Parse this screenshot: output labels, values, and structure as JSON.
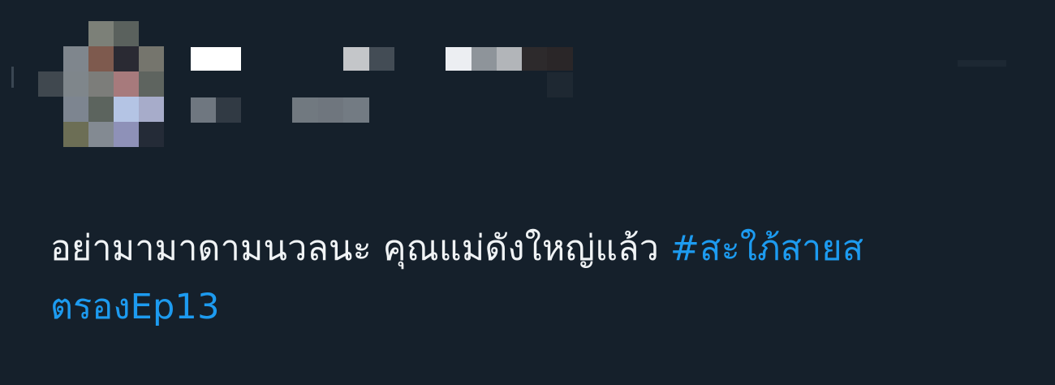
{
  "tweet": {
    "text": "อย่ามามาดามนวลนะ คุณแม่ดังใหญ่แล้ว ",
    "hashtag": "#สะใภ้สายสตรองEp13"
  },
  "avatar": {
    "pixels": [
      {
        "c": "#7c8078"
      },
      {
        "c": "#5a615d"
      },
      {
        "c": "#7f868d"
      },
      {
        "c": "#7e5a4e"
      },
      {
        "c": "#2a2a33"
      },
      {
        "c": "#75756d"
      },
      {
        "c": "#40484f"
      },
      {
        "c": "#7f868b"
      },
      {
        "c": "#7c7d7a"
      },
      {
        "c": "#a77a7c"
      },
      {
        "c": "#5e645f"
      },
      {
        "c": "#7d8590"
      },
      {
        "c": "#5c645e"
      },
      {
        "c": "#b4c4e4"
      },
      {
        "c": "#a7acca"
      },
      {
        "c": "#6c6e55"
      },
      {
        "c": "#838a92"
      },
      {
        "c": "#8e91b8"
      },
      {
        "c": "#242b37"
      }
    ]
  },
  "header": {
    "name_blocks": [
      {
        "c": "#ffffff"
      },
      {
        "c": "#c4c6c9"
      },
      {
        "c": "#434c55"
      },
      {
        "c": "#eceef2"
      },
      {
        "c": "#8e949a"
      },
      {
        "c": "#b2b5b9"
      },
      {
        "c": "#2d2a2c"
      },
      {
        "c": "#2a2628"
      },
      {
        "c": "#1e2832"
      }
    ],
    "meta_blocks": [
      {
        "c": "#6f7780"
      },
      {
        "c": "#313a44"
      },
      {
        "c": "#717980"
      },
      {
        "c": "#6f767e"
      },
      {
        "c": "#737b83"
      }
    ]
  }
}
